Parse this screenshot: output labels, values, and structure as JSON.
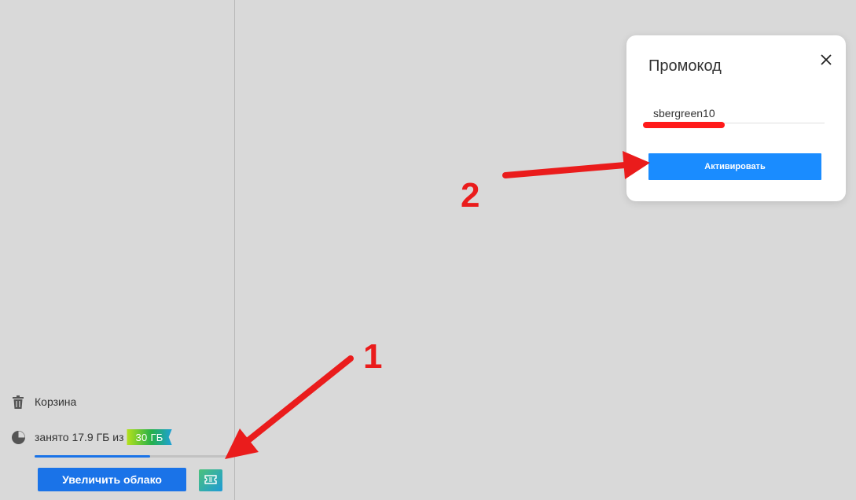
{
  "sidebar": {
    "trash_label": "Корзина",
    "storage": {
      "used_text": "занято 17.9 ГБ из",
      "total_badge": "30 ГБ",
      "used_fraction": 0.597
    },
    "increase_button": "Увеличить облако",
    "promo_icon": "ticket-icon"
  },
  "dialog": {
    "title": "Промокод",
    "close_icon": "close-icon",
    "promo_value": "sbergreen10",
    "activate_button": "Активировать"
  },
  "annotations": {
    "label_1": "1",
    "label_2": "2",
    "color": "#ea1c1c"
  },
  "colors": {
    "accent": "#1a73e8",
    "background": "#d9d9d9"
  }
}
